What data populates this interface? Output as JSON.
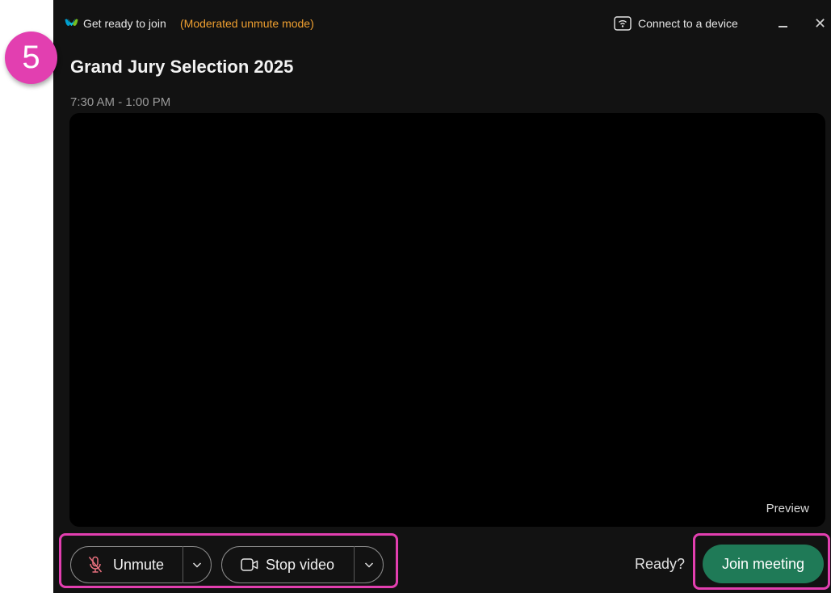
{
  "annotation": {
    "step_number": "5",
    "highlight_color": "#e23fb0"
  },
  "window": {
    "title": "Get ready to join",
    "mode": "(Moderated unmute mode)",
    "mode_color": "#f0a030",
    "connect_label": "Connect to a device",
    "app_icon": "webex-logo-icon",
    "window_controls": [
      "minimize-icon",
      "close-icon"
    ]
  },
  "meeting": {
    "title": "Grand Jury Selection 2025",
    "time": "7:30 AM - 1:00 PM"
  },
  "preview": {
    "label": "Preview"
  },
  "controls": {
    "unmute_label": "Unmute",
    "stop_video_label": "Stop video",
    "icons": [
      "microphone-muted-icon",
      "video-camera-icon",
      "chevron-down-icon"
    ]
  },
  "join": {
    "ready_label": "Ready?",
    "button_label": "Join meeting",
    "button_color": "#1f7a57"
  }
}
